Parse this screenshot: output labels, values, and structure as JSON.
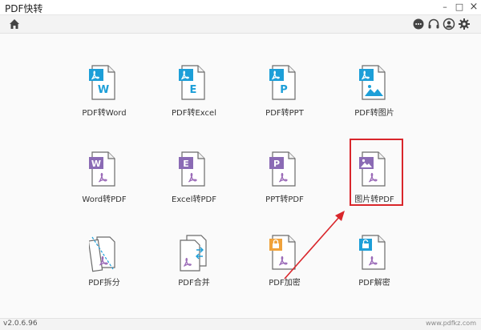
{
  "window": {
    "title": "PDF快转",
    "minimize": "–",
    "maximize": "□",
    "close": "×"
  },
  "toolbar": {
    "home_icon": "home-icon",
    "chat_icon": "chat-icon",
    "support_icon": "headset-icon",
    "user_icon": "user-icon",
    "settings_icon": "gear-icon"
  },
  "tiles": [
    {
      "label": "PDF转Word",
      "letter": "W",
      "band_color": "#1d9fd8",
      "kind": "pdf-to"
    },
    {
      "label": "PDF转Excel",
      "letter": "E",
      "band_color": "#1d9fd8",
      "kind": "pdf-to"
    },
    {
      "label": "PDF转PPT",
      "letter": "P",
      "band_color": "#1d9fd8",
      "kind": "pdf-to"
    },
    {
      "label": "PDF转图片",
      "letter": "",
      "band_color": "#1d9fd8",
      "kind": "pdf-to-image"
    },
    {
      "label": "Word转PDF",
      "letter": "W",
      "band_color": "#8b6bb5",
      "kind": "to-pdf"
    },
    {
      "label": "Excel转PDF",
      "letter": "E",
      "band_color": "#8b6bb5",
      "kind": "to-pdf"
    },
    {
      "label": "PPT转PDF",
      "letter": "P",
      "band_color": "#8b6bb5",
      "kind": "to-pdf"
    },
    {
      "label": "图片转PDF",
      "letter": "",
      "band_color": "#8b6bb5",
      "kind": "image-to-pdf"
    },
    {
      "label": "PDF拆分",
      "letter": "",
      "band_color": "#8b6bb5",
      "kind": "split"
    },
    {
      "label": "PDF合并",
      "letter": "",
      "band_color": "#1d9fd8",
      "kind": "merge"
    },
    {
      "label": "PDF加密",
      "letter": "",
      "band_color": "#f0a23b",
      "kind": "encrypt"
    },
    {
      "label": "PDF解密",
      "letter": "",
      "band_color": "#1d9fd8",
      "kind": "decrypt"
    }
  ],
  "status": {
    "version": "v2.0.6.96",
    "watermark": "www.pdfkz.com"
  },
  "colors": {
    "accent_blue": "#1d9fd8",
    "accent_purple": "#8b6bb5",
    "lock_orange": "#f0a23b",
    "pdf_red": "#9b6bb8",
    "highlight_red": "#d9262b"
  }
}
